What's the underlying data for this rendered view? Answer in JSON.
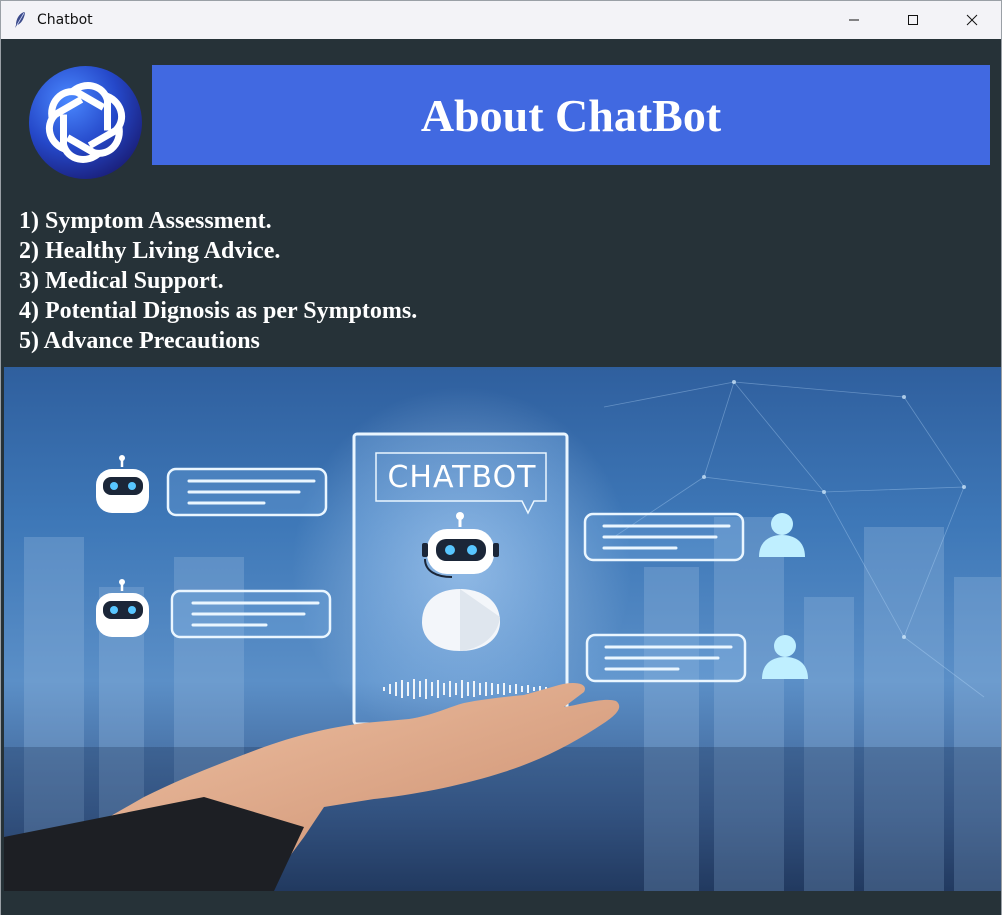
{
  "window": {
    "title": "Chatbot",
    "controls": [
      "minimize",
      "maximize",
      "close"
    ]
  },
  "header": {
    "title": "About ChatBot",
    "banner_color": "#4169e1",
    "logo_icon": "openai-logo-icon"
  },
  "features": [
    "1) Symptom Assessment.",
    "2) Healthy Living Advice.",
    "3) Medical Support.",
    "4) Potential Dignosis as per Symptoms.",
    "5) Advance Precautions"
  ],
  "hero_image": {
    "label": "CHATBOT"
  },
  "colors": {
    "background": "#263238",
    "text": "#ffffff"
  }
}
